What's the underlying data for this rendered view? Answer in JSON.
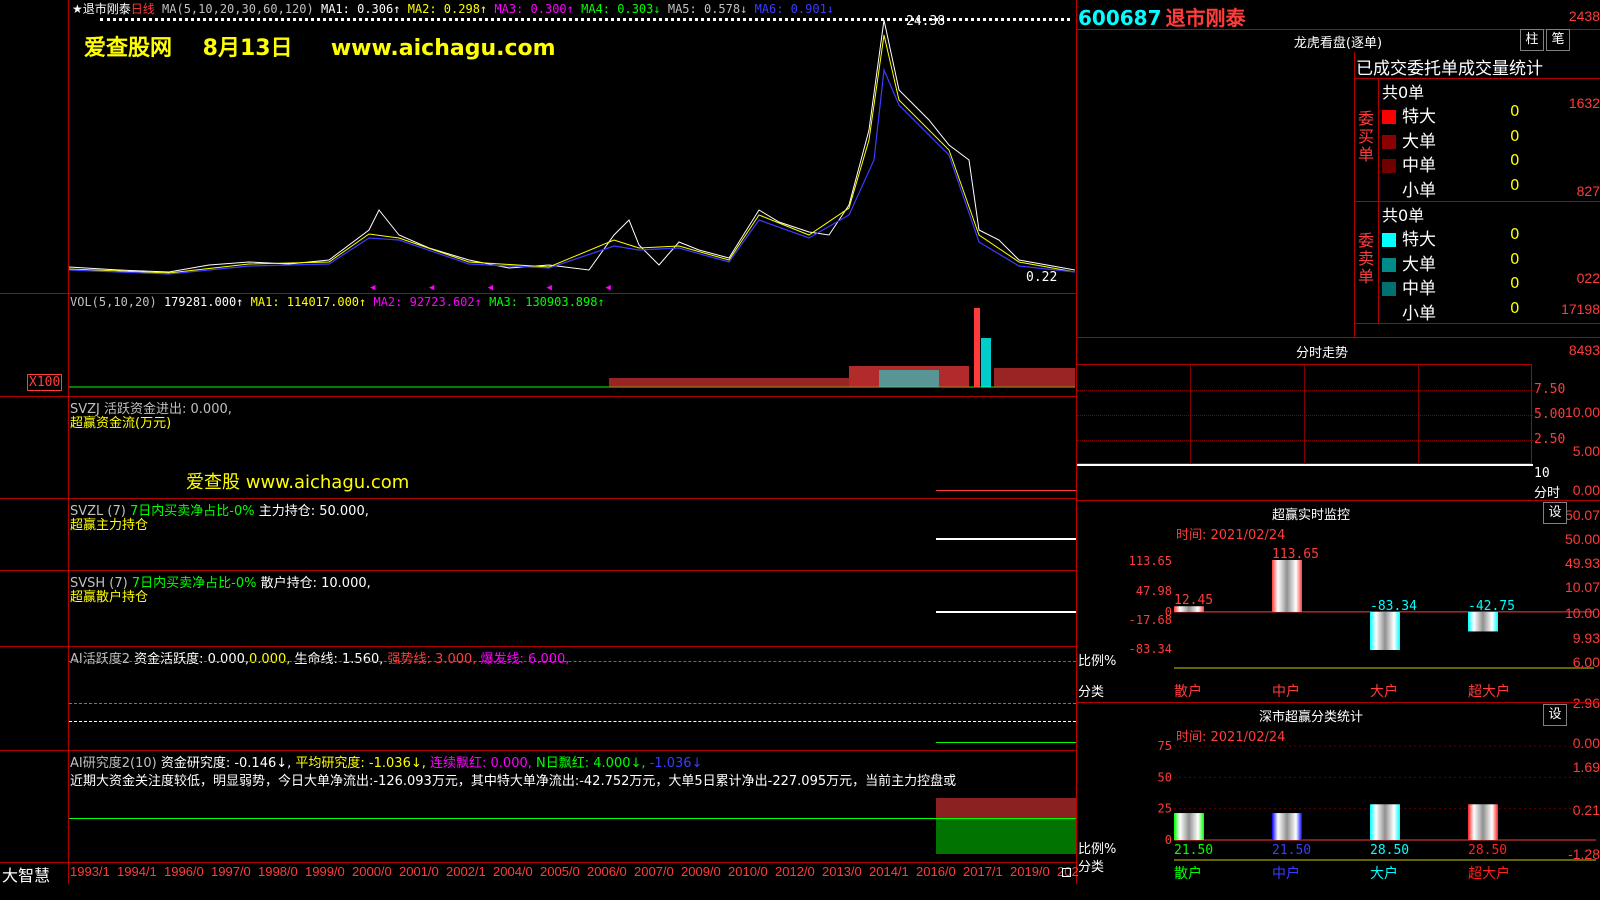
{
  "stock": {
    "code": "600687",
    "name": "退市刚泰",
    "period": "日线"
  },
  "header": {
    "title_prefix": "★退市刚泰",
    "ma_label": "MA(5,10,20,30,60,120)",
    "ma1": "MA1: 0.306↑",
    "ma2": "MA2: 0.298↑",
    "ma3": "MA3: 0.300↑",
    "ma4": "MA4: 0.303↓",
    "ma5": "MA5: 0.578↓",
    "ma6": "MA6: 0.901↓"
  },
  "watermark": {
    "main": "爱查股网    8月13日     www.aichagu.com",
    "svzj": "爱查股 www.aichagu.com"
  },
  "price_panel": {
    "yticks": [
      "2438",
      "1632",
      "827",
      "022"
    ],
    "max_label": "24.38",
    "last_label": "0.22"
  },
  "vol_panel": {
    "title": "VOL(5,10,20)",
    "vol": "179281.000↑",
    "ma1": "MA1: 114017.000↑",
    "ma2": "MA2: 92723.602↑",
    "ma3": "MA3: 130903.898↑",
    "yticks": [
      "17198",
      "8493"
    ],
    "unit": "X100"
  },
  "svzj_panel": {
    "title": "SVZJ  活跃资金进出: 0.000,",
    "subtitle": "超赢资金流(万元)",
    "yticks": [
      "10.00",
      "5.00",
      "0.00"
    ]
  },
  "svzl_panel": {
    "title": "SVZL (7)",
    "ind": "7日内买卖净占比-0%",
    "val": "主力持仓: 50.000,",
    "subtitle": "超赢主力持仓",
    "yticks": [
      "50.07",
      "50.00",
      "49.93"
    ]
  },
  "svsh_panel": {
    "title": "SVSH (7)",
    "ind": "7日内买卖净占比-0%",
    "val": "散户持仓: 10.000,",
    "subtitle": "超赢散户持仓",
    "yticks": [
      "10.07",
      "10.00",
      "9.93"
    ]
  },
  "ai_act_panel": {
    "title": "AI活跃度2",
    "zj": "资金活跃度: 0.000,",
    "v2": "0.000,",
    "sm": "生命线: 1.560,",
    "qs": "强势线: 3.000,",
    "bf": "爆发线: 6.000,",
    "yticks": [
      "6.00",
      "2.96",
      "0.00"
    ]
  },
  "ai_res_panel": {
    "title": "AI研究度2(10)",
    "zj": "资金研究度: -0.146↓,",
    "pj": "平均研究度: -1.036↓,",
    "lx": "连续飘红: 0.000,",
    "nr": "N日飘红: 4.000↓,",
    "v5": "-1.036↓",
    "comment": "近期大资金关注度较低，明显弱势，今日大单净流出:-126.093万元，其中特大单净流出:-42.752万元，大单5日累计净出-227.095万元，当前主力控盘或",
    "yticks": [
      "1.69",
      "0.21",
      "-1.28"
    ]
  },
  "x_axis": [
    "1993/1",
    "1994/1",
    "1996/0",
    "1997/0",
    "1998/0",
    "1999/0",
    "2000/0",
    "2001/0",
    "2002/1",
    "2004/0",
    "2005/0",
    "2006/0",
    "2007/0",
    "2009/0",
    "2010/0",
    "2012/0",
    "2013/0",
    "2014/1",
    "2016/0",
    "2017/1",
    "2019/0",
    "202"
  ],
  "brand": "大智慧",
  "right": {
    "lhkp": {
      "title": "龙虎看盘(逐单)",
      "btn1": "柱",
      "btn2": "笔",
      "header": "已成交委托单成交量统计",
      "buy": {
        "label": "委买单",
        "total": "共0单",
        "rows": [
          {
            "name": "特大",
            "val": "0",
            "color": "#ff0000"
          },
          {
            "name": "大单",
            "val": "0",
            "color": "#8b0000"
          },
          {
            "name": "中单",
            "val": "0",
            "color": "#700000"
          },
          {
            "name": "小单",
            "val": "0",
            "color": "#000000"
          }
        ]
      },
      "sell": {
        "label": "委卖单",
        "total": "共0单",
        "rows": [
          {
            "name": "特大",
            "val": "0",
            "color": "#00ffff"
          },
          {
            "name": "大单",
            "val": "0",
            "color": "#008b8b"
          },
          {
            "name": "中单",
            "val": "0",
            "color": "#007070"
          },
          {
            "name": "小单",
            "val": "0",
            "color": "#000000"
          }
        ]
      }
    },
    "fszs": {
      "title": "分时走势",
      "yticks": [
        "7.50",
        "5.00",
        "2.50"
      ],
      "xlabel": "10",
      "xunit": "分时"
    },
    "monitor": {
      "title": "超赢实时监控",
      "btn": "设",
      "time": "时间: 2021/02/24",
      "yticks": [
        "113.65",
        "47.98",
        "0",
        "-17.68",
        "-83.34"
      ],
      "ylabel1": "比例%",
      "ylabel2": "分类",
      "bars": [
        {
          "cat": "散户",
          "val": 12.45,
          "label": "12.45"
        },
        {
          "cat": "中户",
          "val": 113.65,
          "label": "113.65"
        },
        {
          "cat": "大户",
          "val": -83.34,
          "label": "-83.34"
        },
        {
          "cat": "超大户",
          "val": -42.75,
          "label": "-42.75"
        }
      ]
    },
    "classify": {
      "title": "深市超赢分类统计",
      "btn": "设",
      "time": "时间: 2021/02/24",
      "yticks": [
        "75",
        "50",
        "25",
        "0"
      ],
      "ylabel1": "比例%",
      "ylabel2": "分类",
      "bars": [
        {
          "cat": "散户",
          "val": 21.5,
          "label": "21.50",
          "color": "#00ff00"
        },
        {
          "cat": "中户",
          "val": 21.5,
          "label": "21.50",
          "color": "#0000ff"
        },
        {
          "cat": "大户",
          "val": 28.5,
          "label": "28.50",
          "color": "#00ffff"
        },
        {
          "cat": "超大户",
          "val": 28.5,
          "label": "28.50",
          "color": "#ff2020"
        }
      ]
    }
  }
}
